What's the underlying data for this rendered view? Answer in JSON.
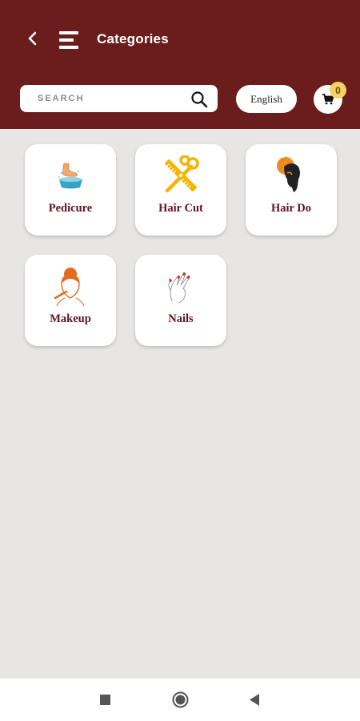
{
  "header": {
    "title": "Categories",
    "background_color": "#6b1d1d",
    "back_icon": "chevron-left-icon",
    "menu_icon": "menu-icon"
  },
  "search": {
    "placeholder": "SEARCH",
    "value": "",
    "icon": "search-icon"
  },
  "language": {
    "selected": "English"
  },
  "cart": {
    "icon": "cart-icon",
    "count": "0",
    "badge_color": "#f3d463"
  },
  "categories": [
    {
      "label": "Pedicure",
      "icon": "pedicure-icon"
    },
    {
      "label": "Hair Cut",
      "icon": "scissors-comb-icon"
    },
    {
      "label": "Hair Do",
      "icon": "hairdo-icon"
    },
    {
      "label": "Makeup",
      "icon": "makeup-icon"
    },
    {
      "label": "Nails",
      "icon": "nails-icon"
    }
  ],
  "navbar": {
    "items": [
      "recents-icon",
      "home-icon",
      "back-icon"
    ]
  }
}
